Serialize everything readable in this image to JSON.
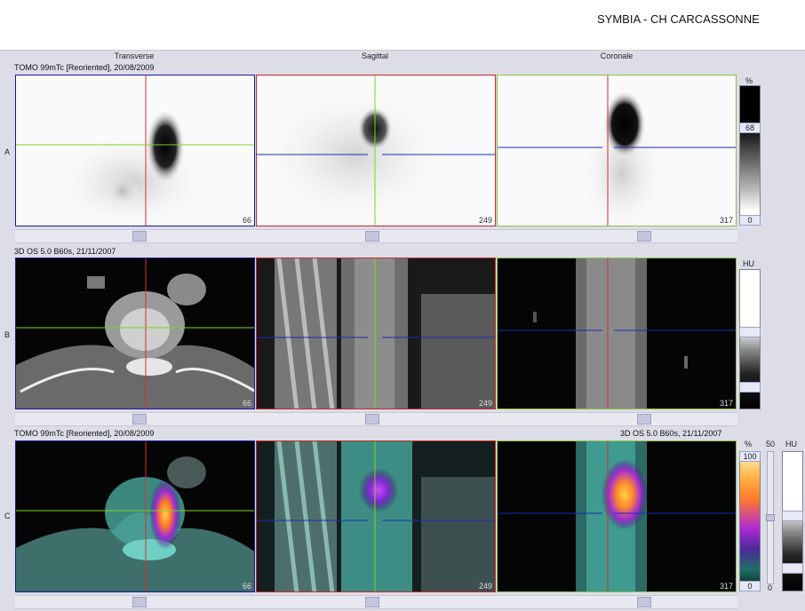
{
  "header": {
    "title": "SYMBIA - CH CARCASSONNE"
  },
  "columns": [
    "Transverse",
    "Sagittal",
    "Coronale"
  ],
  "rows": {
    "A": {
      "label": "A",
      "series": "TOMO 99mTc [Reoriented], 20/08/2009",
      "slices": [
        "66",
        "249",
        "317"
      ],
      "scale": {
        "unit": "%",
        "max": "68",
        "min": "0"
      }
    },
    "B": {
      "label": "B",
      "series": "3D  OS  5.0  B60s, 21/11/2007",
      "slices": [
        "66",
        "249",
        "317"
      ],
      "scale": {
        "unit": "HU"
      }
    },
    "C": {
      "label": "C",
      "series_left": "TOMO 99mTc [Reoriented], 20/08/2009",
      "series_right": "3D  OS  5.0  B60s, 21/11/2007",
      "slices": [
        "66",
        "249",
        "317"
      ],
      "scale": {
        "unit": "%",
        "max": "100",
        "min": "0",
        "blend": "50",
        "blend_min": "0",
        "unit2": "HU"
      }
    }
  },
  "colors": {
    "transverse": "#1a1aa0",
    "sagittal": "#c62828",
    "coronale": "#8bc34a",
    "crosshair_h_a": "#7ed321",
    "crosshair_blue": "#1c2bb8"
  }
}
